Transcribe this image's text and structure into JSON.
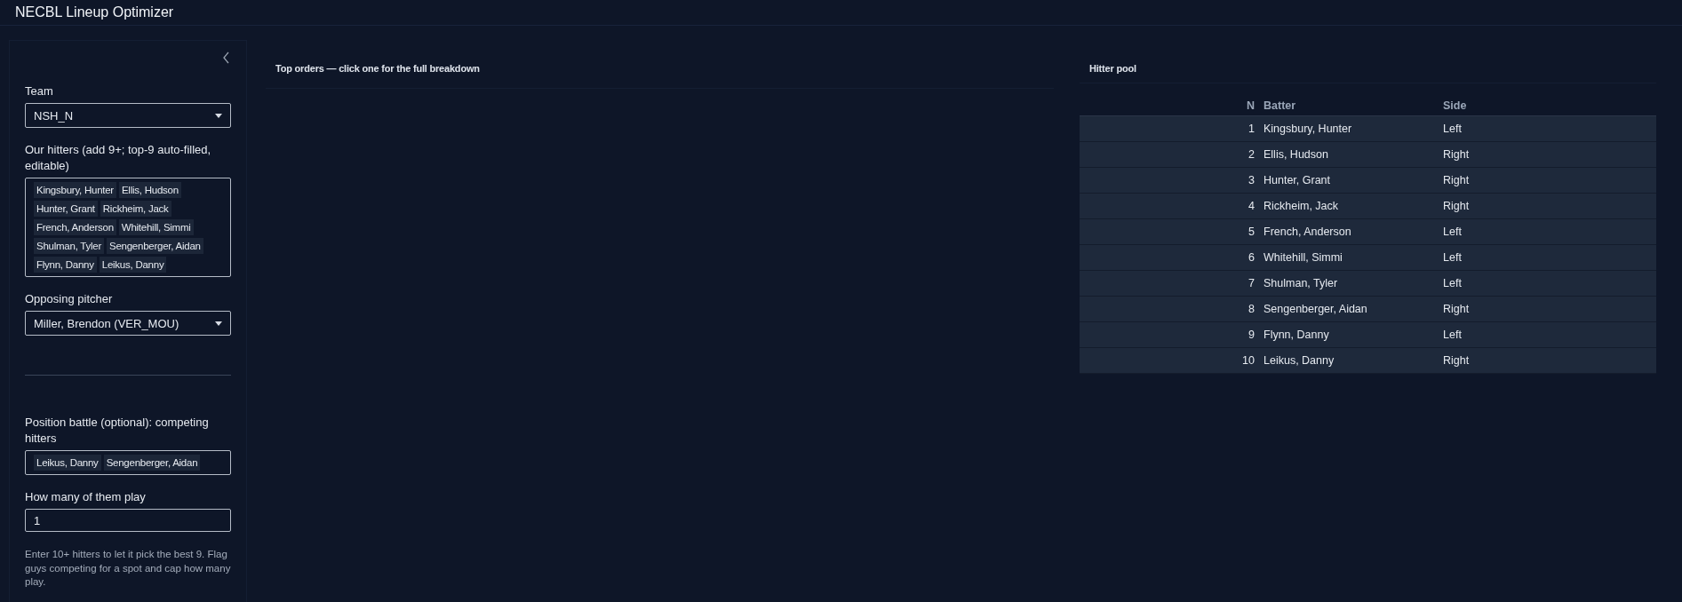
{
  "app_title": "NECBL Lineup Optimizer",
  "sidebar": {
    "team": {
      "label": "Team",
      "value": "NSH_N"
    },
    "hitters": {
      "label": "Our hitters (add 9+; top-9 auto-filled, editable)",
      "tags": [
        "Kingsbury, Hunter",
        "Ellis, Hudson",
        "Hunter, Grant",
        "Rickheim, Jack",
        "French, Anderson",
        "Whitehill, Simmi",
        "Shulman, Tyler",
        "Sengenberger, Aidan",
        "Flynn, Danny",
        "Leikus, Danny"
      ]
    },
    "pitcher": {
      "label": "Opposing pitcher",
      "value": "Miller, Brendon (VER_MOU)"
    },
    "battle": {
      "label": "Position battle (optional): competing hitters",
      "tags": [
        "Leikus, Danny",
        "Sengenberger, Aidan"
      ]
    },
    "how_many": {
      "label": "How many of them play",
      "value": "1"
    },
    "help": "Enter 10+ hitters to let it pick the best 9. Flag guys competing for a spot and cap how many play."
  },
  "top_orders": {
    "title": "Top orders — click one for the full breakdown"
  },
  "hitter_pool": {
    "title": "Hitter pool",
    "columns": [
      "N",
      "Batter",
      "Side"
    ],
    "rows": [
      {
        "n": "1",
        "batter": "Kingsbury, Hunter",
        "side": "Left"
      },
      {
        "n": "2",
        "batter": "Ellis, Hudson",
        "side": "Right"
      },
      {
        "n": "3",
        "batter": "Hunter, Grant",
        "side": "Right"
      },
      {
        "n": "4",
        "batter": "Rickheim, Jack",
        "side": "Right"
      },
      {
        "n": "5",
        "batter": "French, Anderson",
        "side": "Left"
      },
      {
        "n": "6",
        "batter": "Whitehill, Simmi",
        "side": "Left"
      },
      {
        "n": "7",
        "batter": "Shulman, Tyler",
        "side": "Left"
      },
      {
        "n": "8",
        "batter": "Sengenberger, Aidan",
        "side": "Right"
      },
      {
        "n": "9",
        "batter": "Flynn, Danny",
        "side": "Left"
      },
      {
        "n": "10",
        "batter": "Leikus, Danny",
        "side": "Right"
      }
    ]
  }
}
